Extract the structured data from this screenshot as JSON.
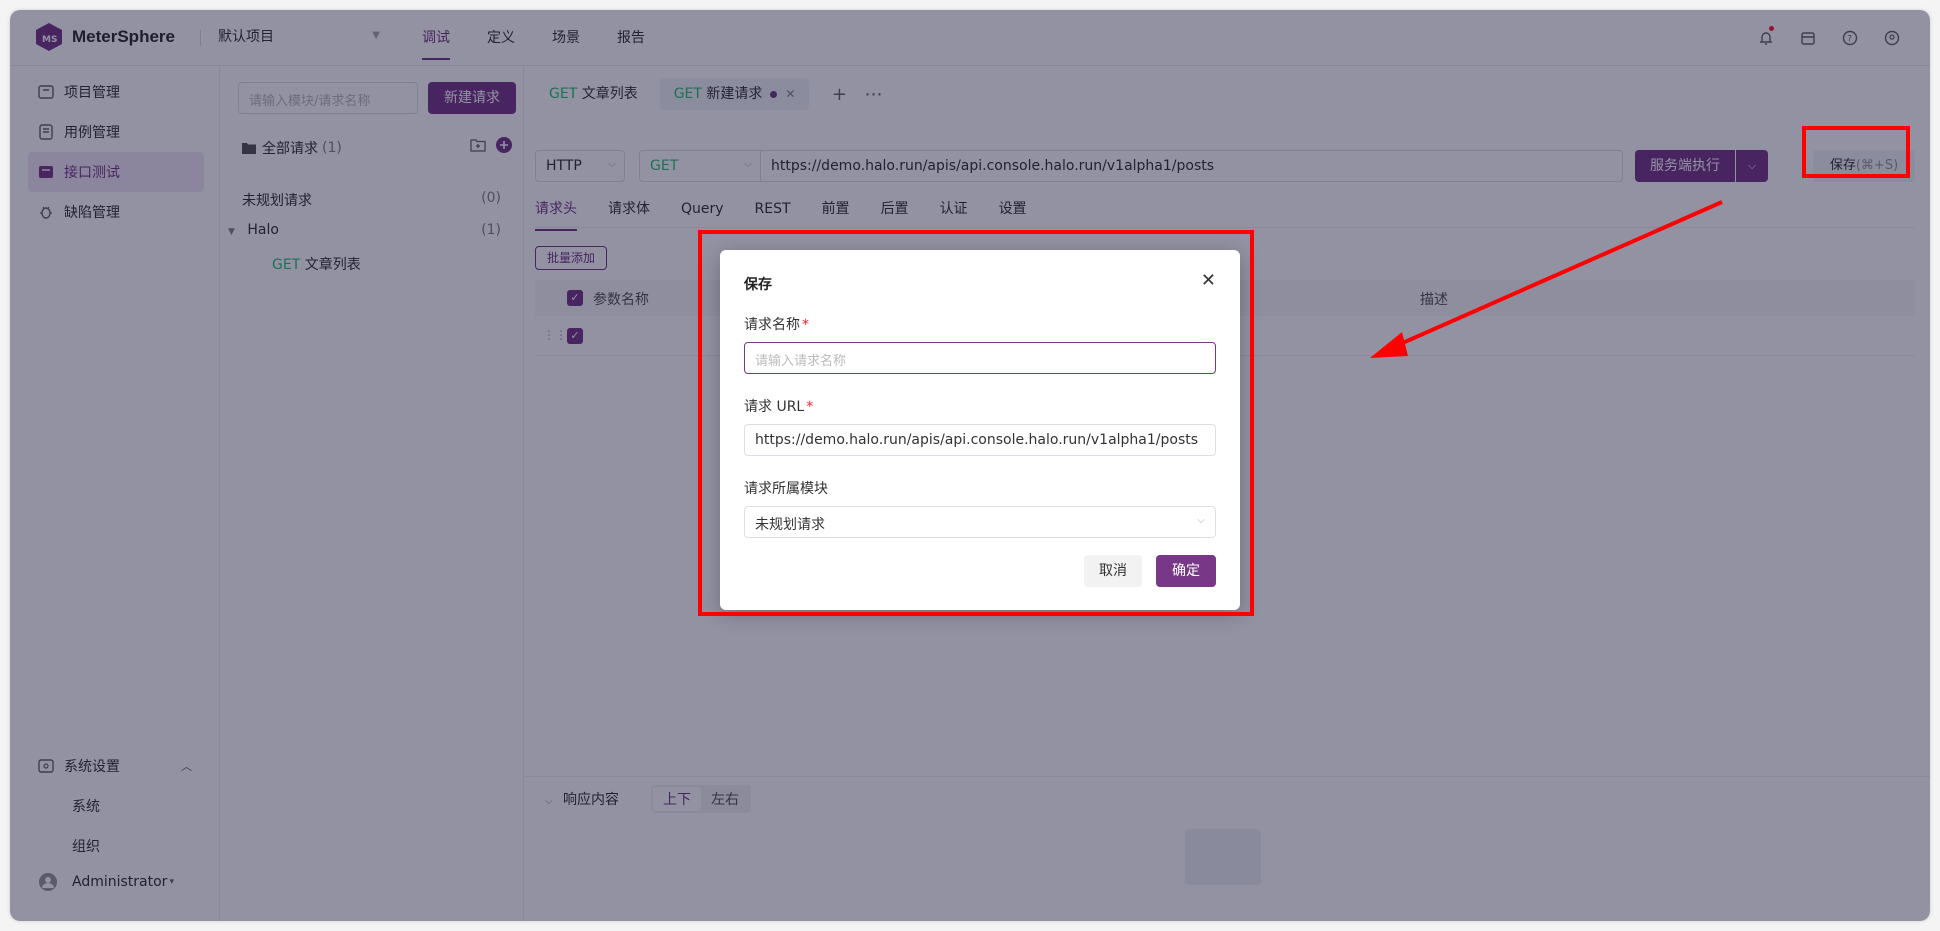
{
  "app": {
    "name": "MeterSphere",
    "project": "默认项目"
  },
  "topnav": [
    {
      "label": "调试",
      "active": true
    },
    {
      "label": "定义",
      "active": false
    },
    {
      "label": "场景",
      "active": false
    },
    {
      "label": "报告",
      "active": false
    }
  ],
  "top_icons": [
    "bell-icon",
    "calendar-icon",
    "help-icon",
    "user-icon"
  ],
  "sidebar": {
    "items": [
      {
        "label": "项目管理",
        "icon": "project-icon",
        "active": false
      },
      {
        "label": "用例管理",
        "icon": "case-icon",
        "active": false
      },
      {
        "label": "接口测试",
        "icon": "api-icon",
        "active": true
      },
      {
        "label": "缺陷管理",
        "icon": "bug-icon",
        "active": false
      }
    ],
    "settings": {
      "label": "系统设置",
      "children": [
        "系统",
        "组织"
      ]
    },
    "user": "Administrator"
  },
  "tree": {
    "search_placeholder": "请输入模块/请求名称",
    "new_button": "新建请求",
    "root_label": "全部请求",
    "root_count": "(1)",
    "nodes": [
      {
        "label": "未规划请求",
        "count": "(0)"
      },
      {
        "label": "Halo",
        "count": "(1)"
      }
    ],
    "leaf": {
      "method": "GET",
      "label": "文章列表"
    }
  },
  "tabs": [
    {
      "method": "GET",
      "label": "文章列表"
    },
    {
      "method": "GET",
      "label": "新建请求"
    }
  ],
  "request": {
    "protocol": "HTTP",
    "method": "GET",
    "url": "https://demo.halo.run/apis/api.console.halo.run/v1alpha1/posts",
    "execute": "服务端执行",
    "save": "保存",
    "save_shortcut": "(⌘+S)"
  },
  "subtabs": [
    "请求头",
    "请求体",
    "Query",
    "REST",
    "前置",
    "后置",
    "认证",
    "设置"
  ],
  "table": {
    "batch_add": "批量添加",
    "col_name": "参数名称",
    "col_desc": "描述"
  },
  "response": {
    "title": "响应内容",
    "layout_options": [
      "上下",
      "左右"
    ]
  },
  "modal": {
    "title": "保存",
    "name_label": "请求名称",
    "name_placeholder": "请输入请求名称",
    "url_label": "请求 URL",
    "url_value": "https://demo.halo.run/apis/api.console.halo.run/v1alpha1/posts",
    "module_label": "请求所属模块",
    "module_value": "未规划请求",
    "cancel": "取消",
    "ok": "确定",
    "required_mark": "*"
  },
  "colors": {
    "brand": "#783887",
    "get": "#2bc36e",
    "annotation": "#ff0000"
  }
}
